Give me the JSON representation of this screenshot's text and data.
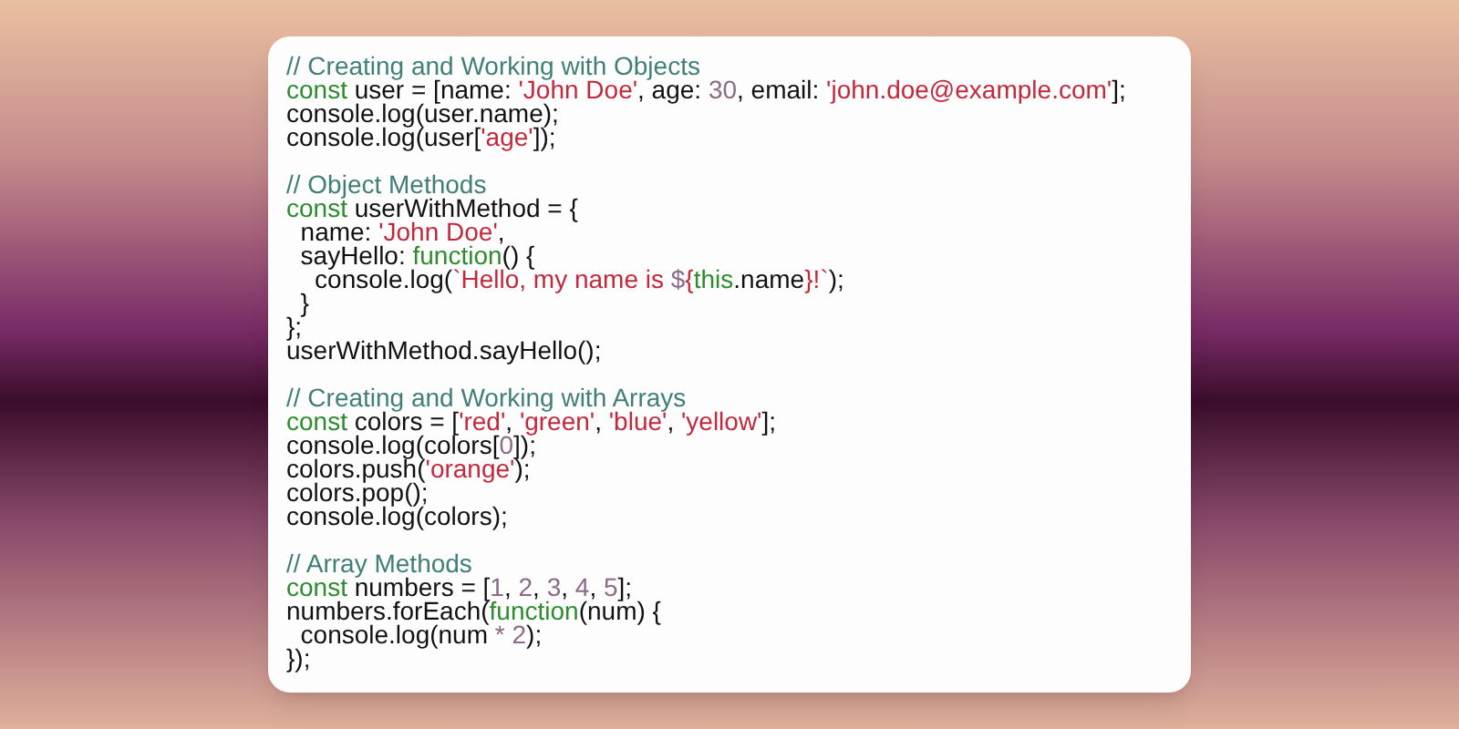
{
  "code_blocks": [
    {
      "lines": [
        [
          {
            "kind": "comment",
            "text": "// Creating and Working with Objects"
          }
        ],
        [
          {
            "kind": "keyword",
            "text": "const"
          },
          {
            "kind": "plain",
            "text": " user = [name: "
          },
          {
            "kind": "string",
            "text": "'John Doe'"
          },
          {
            "kind": "plain",
            "text": ", age: "
          },
          {
            "kind": "number",
            "text": "30"
          },
          {
            "kind": "plain",
            "text": ", email: "
          },
          {
            "kind": "string",
            "text": "'john.doe@example.com'"
          },
          {
            "kind": "plain",
            "text": "];"
          }
        ],
        [
          {
            "kind": "plain",
            "text": "console.log(user.name);"
          }
        ],
        [
          {
            "kind": "plain",
            "text": "console.log(user["
          },
          {
            "kind": "string",
            "text": "'age'"
          },
          {
            "kind": "plain",
            "text": "]);"
          }
        ]
      ]
    },
    {
      "lines": [
        [
          {
            "kind": "comment",
            "text": "// Object Methods"
          }
        ],
        [
          {
            "kind": "keyword",
            "text": "const"
          },
          {
            "kind": "plain",
            "text": " userWithMethod = {"
          }
        ],
        [
          {
            "kind": "plain",
            "text": "  name: "
          },
          {
            "kind": "string",
            "text": "'John Doe'"
          },
          {
            "kind": "plain",
            "text": ","
          }
        ],
        [
          {
            "kind": "plain",
            "text": "  sayHello: "
          },
          {
            "kind": "keyword",
            "text": "function"
          },
          {
            "kind": "plain",
            "text": "() {"
          }
        ],
        [
          {
            "kind": "plain",
            "text": "    console.log("
          },
          {
            "kind": "string",
            "text": "`Hello, my name is "
          },
          {
            "kind": "number",
            "text": "$"
          },
          {
            "kind": "string",
            "text": "{"
          },
          {
            "kind": "keyword",
            "text": "this"
          },
          {
            "kind": "plain",
            "text": ".name"
          },
          {
            "kind": "string",
            "text": "}!`"
          },
          {
            "kind": "plain",
            "text": ");"
          }
        ],
        [
          {
            "kind": "plain",
            "text": "  }"
          }
        ],
        [
          {
            "kind": "plain",
            "text": "};"
          }
        ],
        [
          {
            "kind": "plain",
            "text": "userWithMethod.sayHello();"
          }
        ]
      ]
    },
    {
      "lines": [
        [
          {
            "kind": "comment",
            "text": "// Creating and Working with Arrays"
          }
        ],
        [
          {
            "kind": "keyword",
            "text": "const"
          },
          {
            "kind": "plain",
            "text": " colors = ["
          },
          {
            "kind": "string",
            "text": "'red'"
          },
          {
            "kind": "plain",
            "text": ", "
          },
          {
            "kind": "string",
            "text": "'green'"
          },
          {
            "kind": "plain",
            "text": ", "
          },
          {
            "kind": "string",
            "text": "'blue'"
          },
          {
            "kind": "plain",
            "text": ", "
          },
          {
            "kind": "string",
            "text": "'yellow'"
          },
          {
            "kind": "plain",
            "text": "];"
          }
        ],
        [
          {
            "kind": "plain",
            "text": "console.log(colors["
          },
          {
            "kind": "number",
            "text": "0"
          },
          {
            "kind": "plain",
            "text": "]);"
          }
        ],
        [
          {
            "kind": "plain",
            "text": "colors.push("
          },
          {
            "kind": "string",
            "text": "'orange'"
          },
          {
            "kind": "plain",
            "text": ");"
          }
        ],
        [
          {
            "kind": "plain",
            "text": "colors.pop();"
          }
        ],
        [
          {
            "kind": "plain",
            "text": "console.log(colors);"
          }
        ]
      ]
    },
    {
      "lines": [
        [
          {
            "kind": "comment",
            "text": "// Array Methods"
          }
        ],
        [
          {
            "kind": "keyword",
            "text": "const"
          },
          {
            "kind": "plain",
            "text": " numbers = ["
          },
          {
            "kind": "number",
            "text": "1"
          },
          {
            "kind": "plain",
            "text": ", "
          },
          {
            "kind": "number",
            "text": "2"
          },
          {
            "kind": "plain",
            "text": ", "
          },
          {
            "kind": "number",
            "text": "3"
          },
          {
            "kind": "plain",
            "text": ", "
          },
          {
            "kind": "number",
            "text": "4"
          },
          {
            "kind": "plain",
            "text": ", "
          },
          {
            "kind": "number",
            "text": "5"
          },
          {
            "kind": "plain",
            "text": "];"
          }
        ],
        [
          {
            "kind": "plain",
            "text": "numbers.forEach("
          },
          {
            "kind": "keyword",
            "text": "function"
          },
          {
            "kind": "plain",
            "text": "(num) {"
          }
        ],
        [
          {
            "kind": "plain",
            "text": "  console.log(num "
          },
          {
            "kind": "number",
            "text": "* 2"
          },
          {
            "kind": "plain",
            "text": ");"
          }
        ],
        [
          {
            "kind": "plain",
            "text": "});"
          }
        ]
      ]
    }
  ]
}
